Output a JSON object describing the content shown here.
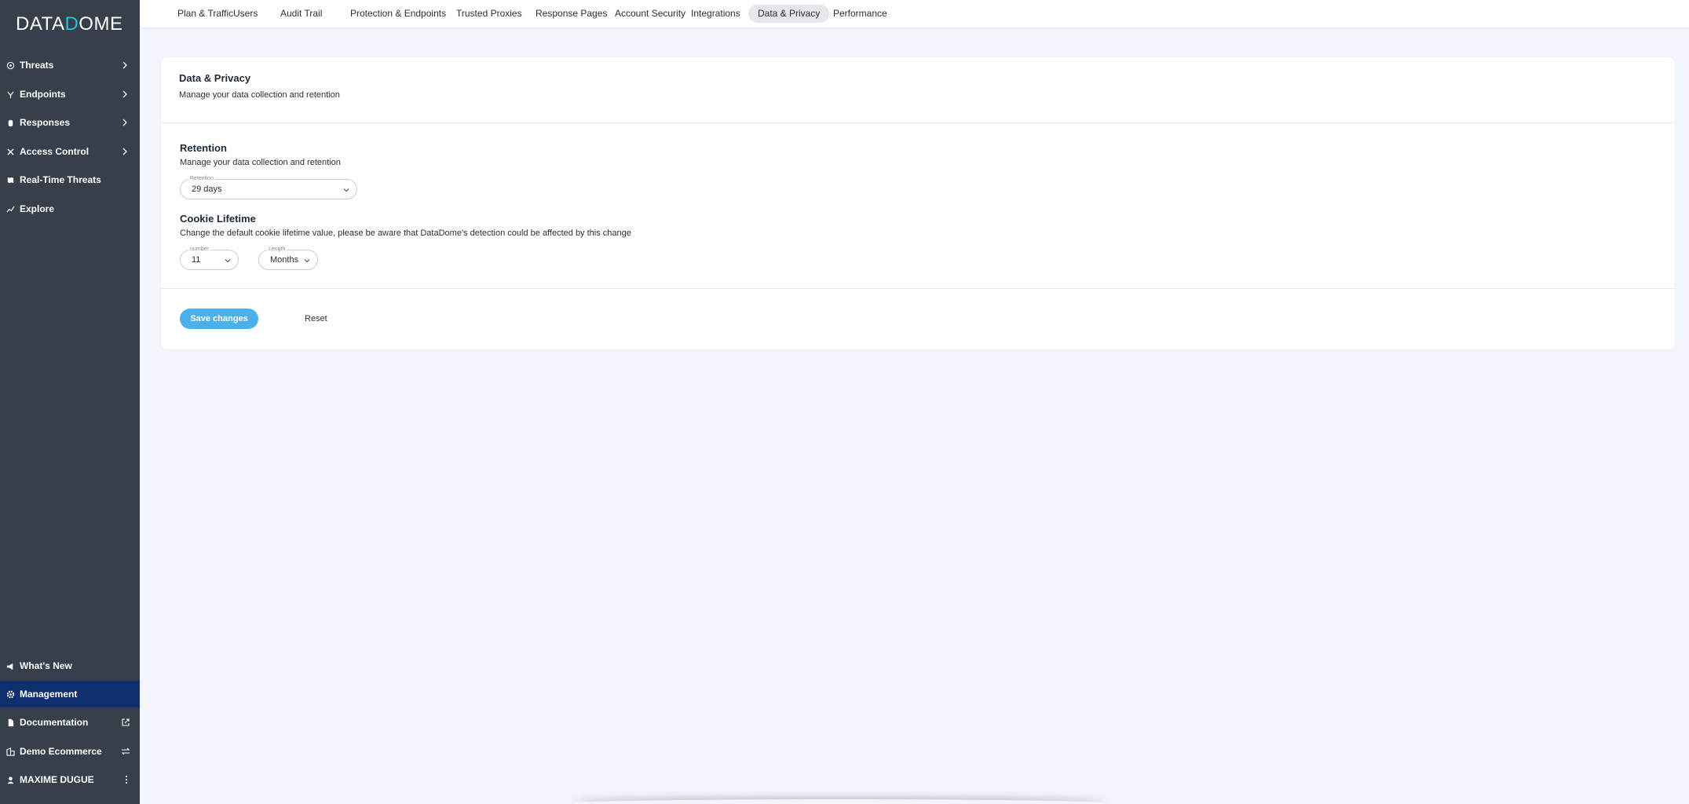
{
  "brand": {
    "logo_left": "DATA",
    "logo_d": "D",
    "logo_right": "OME"
  },
  "sidebar": {
    "top_items": [
      {
        "label": "Threats",
        "icon": "radar-icon",
        "has_chevron": true
      },
      {
        "label": "Endpoints",
        "icon": "endpoints-icon",
        "has_chevron": true
      },
      {
        "label": "Responses",
        "icon": "hand-icon",
        "has_chevron": true
      },
      {
        "label": "Access Control",
        "icon": "tools-icon",
        "has_chevron": true
      },
      {
        "label": "Real-Time Threats",
        "icon": "map-icon",
        "has_chevron": false
      },
      {
        "label": "Explore",
        "icon": "chart-icon",
        "has_chevron": false
      }
    ],
    "bottom_items": [
      {
        "label": "What's New",
        "icon": "megaphone-icon"
      },
      {
        "label": "Management",
        "icon": "gear-icon",
        "active": true
      },
      {
        "label": "Documentation",
        "icon": "document-icon",
        "trailing": "external-link-icon"
      },
      {
        "label": "Demo Ecommerce",
        "icon": "building-icon",
        "trailing": "swap-icon"
      },
      {
        "label": "MAXIME DUGUE",
        "icon": "user-icon",
        "trailing": "kebab-icon"
      }
    ]
  },
  "tabs": [
    {
      "label": "Plan & Traffic"
    },
    {
      "label": "Users"
    },
    {
      "label": "Audit Trail"
    },
    {
      "label": "Protection & Endpoints"
    },
    {
      "label": "Trusted Proxies"
    },
    {
      "label": "Response Pages"
    },
    {
      "label": "Account Security"
    },
    {
      "label": "Integrations"
    },
    {
      "label": "Data & Privacy",
      "active": true
    },
    {
      "label": "Performance"
    }
  ],
  "card": {
    "title": "Data & Privacy",
    "subtitle": "Manage your data collection and retention",
    "retention": {
      "title": "Retention",
      "subtitle": "Manage your data collection and retention",
      "field_label": "Retention",
      "value": "29 days"
    },
    "cookie": {
      "title": "Cookie Lifetime",
      "subtitle": "Change the default cookie lifetime value, please be aware that DataDome's detection could be affected by this change",
      "number_label": "number",
      "number_value": "11",
      "length_label": "Length",
      "length_value": "Months"
    },
    "save_label": "Save changes",
    "reset_label": "Reset"
  },
  "colors": {
    "sidebar_bg": "#363f4a",
    "active_nav": "#0f2f6e",
    "accent": "#4bb1ec",
    "logo_accent": "#27c1d9"
  }
}
